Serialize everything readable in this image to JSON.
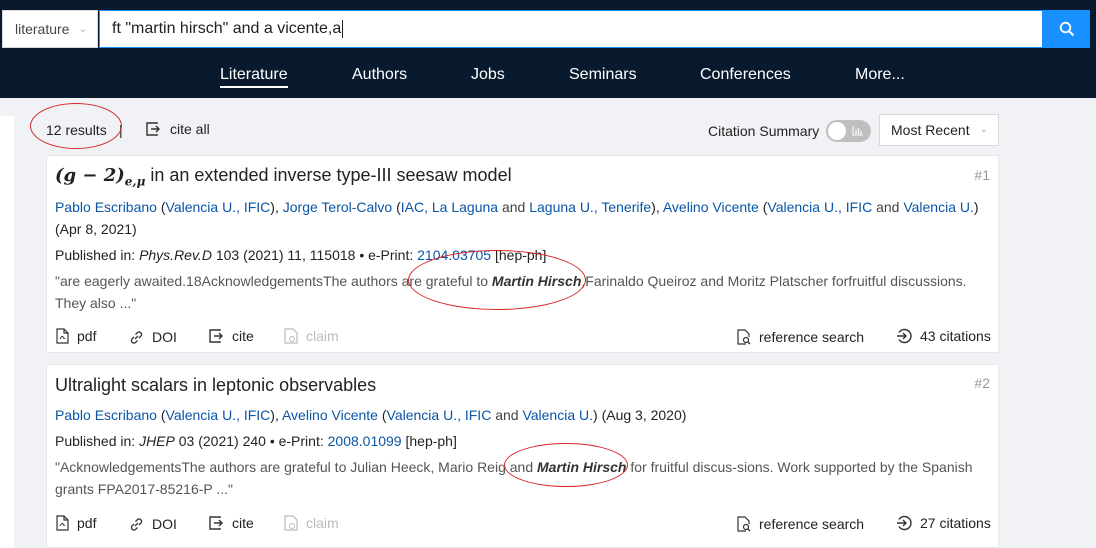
{
  "search": {
    "scope": "literature",
    "query": "ft \"martin hirsch\" and a vicente,a",
    "button_icon": "search-icon"
  },
  "nav": [
    "Literature",
    "Authors",
    "Jobs",
    "Seminars",
    "Conferences",
    "More..."
  ],
  "results": {
    "count": "12 results",
    "separator": "|",
    "cite_all": "cite all",
    "citation_summary": "Citation Summary",
    "sort": "Most Recent"
  },
  "records": [
    {
      "number": "#1",
      "title_math": "(g − 2)",
      "title_sub": "e,μ",
      "title_rest": " in an extended inverse type-III seesaw model",
      "authors": {
        "a1": "Pablo Escribano",
        "a1_aff1": "Valencia U., IFIC",
        "a2": "Jorge Terol-Calvo",
        "a2_aff1": "IAC, La Laguna",
        "a2_and": "and",
        "a2_aff2": "Laguna U., Tenerife",
        "a3": "Avelino Vicente",
        "a3_aff1": "Valencia U., IFIC",
        "a3_and": "and",
        "a3_aff2": "Valencia U.",
        "date": "(Apr 8, 2021)"
      },
      "published_label": "Published in:",
      "journal": "Phys.Rev.D",
      "journal_rest": "103 (2021) 11, 115018 • e-Print:",
      "eprint": "2104.03705",
      "category": "[hep-ph]",
      "snippet_before": "\"are eagerly awaited.18AcknowledgementsThe authors are grateful to ",
      "snippet_highlight": "Martin Hirsch",
      "snippet_after": ",Farinaldo Queiroz and Moritz Platscher forfruitful discussions. They also ...\"",
      "actions": {
        "pdf": "pdf",
        "doi": "DOI",
        "cite": "cite",
        "claim": "claim",
        "reference_search": "reference search",
        "citations": "43 citations"
      }
    },
    {
      "number": "#2",
      "title": "Ultralight scalars in leptonic observables",
      "authors": {
        "a1": "Pablo Escribano",
        "a1_aff1": "Valencia U., IFIC",
        "a2": "Avelino Vicente",
        "a2_aff1": "Valencia U., IFIC",
        "a2_and": "and",
        "a2_aff2": "Valencia U.",
        "date": "(Aug 3, 2020)"
      },
      "published_label": "Published in:",
      "journal": "JHEP",
      "journal_rest": "03 (2021) 240 • e-Print:",
      "eprint": "2008.01099",
      "category": "[hep-ph]",
      "snippet_before": "\"AcknowledgementsThe authors are grateful to Julian Heeck, Mario Reig and ",
      "snippet_highlight": "Martin Hirsch",
      "snippet_after": " for fruitful discus-sions. Work supported by the Spanish grants FPA2017-85216-P ...\"",
      "actions": {
        "pdf": "pdf",
        "doi": "DOI",
        "cite": "cite",
        "claim": "claim",
        "reference_search": "reference search",
        "citations": "27 citations"
      }
    }
  ],
  "colors": {
    "navy": "#0a1a2e",
    "accent": "#1890ff",
    "link": "#0a55a5",
    "annotation": "#d62728"
  }
}
